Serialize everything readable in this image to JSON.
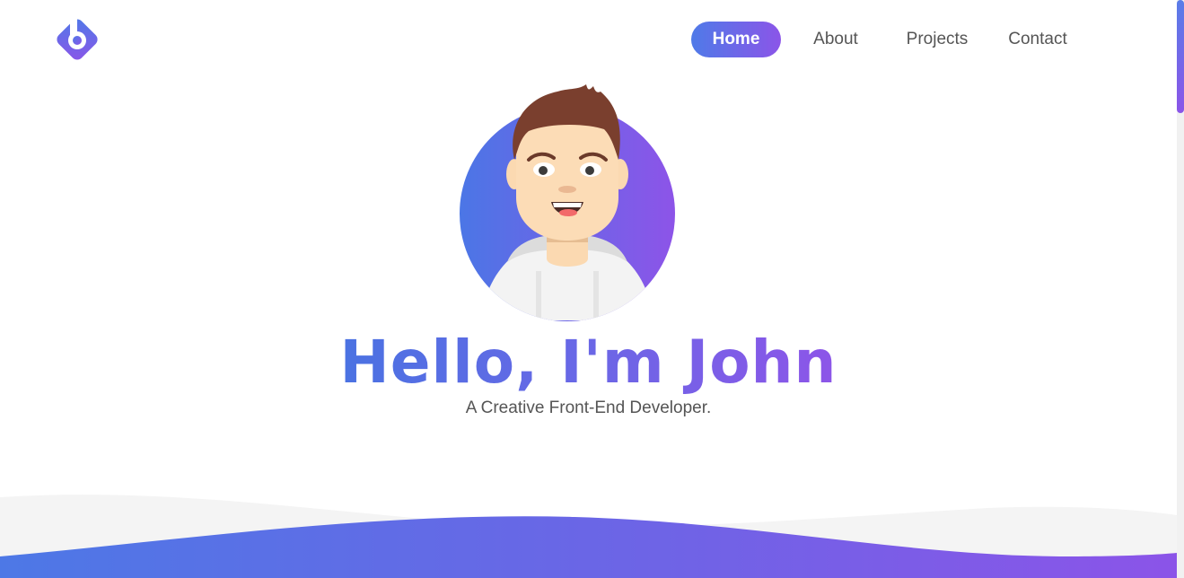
{
  "logo": {
    "icon": "logo-b-diamond-icon"
  },
  "nav": {
    "items": [
      {
        "label": "Home",
        "active": true
      },
      {
        "label": "About",
        "active": false
      },
      {
        "label": "Projects",
        "active": false
      },
      {
        "label": "Contact",
        "active": false
      }
    ]
  },
  "hero": {
    "avatar_icon": "avatar-illustration-icon",
    "title": "Hello, I'm John",
    "subtitle": "A Creative Front-End Developer."
  },
  "colors": {
    "accent_start": "#4f7ae8",
    "accent_end": "#8b55e8",
    "text_muted": "#555555",
    "wave_light": "#f4f4f4"
  }
}
